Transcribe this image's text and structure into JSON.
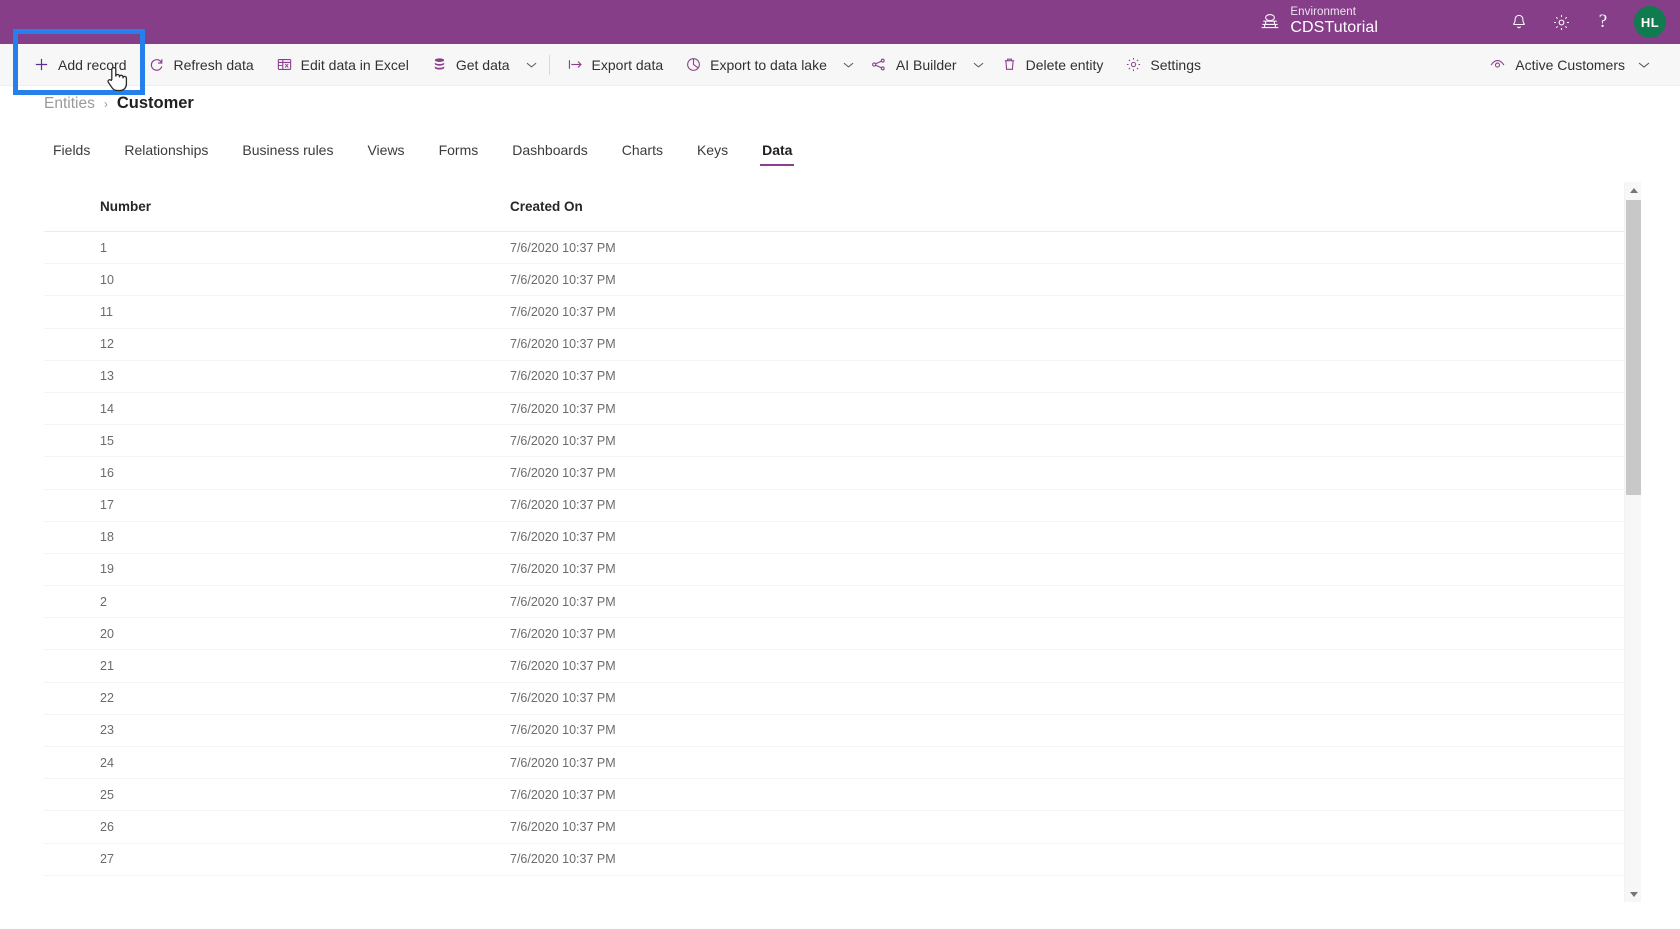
{
  "header": {
    "environment_label": "Environment",
    "environment_name": "CDSTutorial",
    "globe_icon": "environment-globe-icon",
    "notifications_icon": "bell-icon",
    "settings_icon": "gear-icon",
    "help_icon": "question-mark-icon",
    "help_glyph": "?",
    "avatar_initials": "HL",
    "brand_color": "#853e87",
    "avatar_color": "#0f7b4f"
  },
  "command_bar": {
    "buttons": [
      {
        "label": "Add record",
        "icon": "plus-icon",
        "has_caret": false,
        "highlighted": true
      },
      {
        "label": "Refresh data",
        "icon": "refresh-icon",
        "has_caret": false,
        "highlighted": false
      },
      {
        "label": "Edit data in Excel",
        "icon": "excel-icon",
        "has_caret": false,
        "highlighted": false
      },
      {
        "label": "Get data",
        "icon": "database-icon",
        "has_caret": true,
        "highlighted": false
      },
      {
        "label": "Export data",
        "icon": "export-arrow-icon",
        "has_caret": false,
        "highlighted": false
      },
      {
        "label": "Export to data lake",
        "icon": "data-lake-icon",
        "has_caret": true,
        "highlighted": false
      },
      {
        "label": "AI Builder",
        "icon": "ai-builder-icon",
        "has_caret": true,
        "highlighted": false
      },
      {
        "label": "Delete entity",
        "icon": "trash-icon",
        "has_caret": false,
        "highlighted": false
      },
      {
        "label": "Settings",
        "icon": "gear-icon",
        "has_caret": false,
        "highlighted": false
      }
    ],
    "view_selector": {
      "label": "Active Customers",
      "icon": "view-eye-icon",
      "caret_icon": "chevron-down-icon"
    },
    "highlight_color": "#2680eb",
    "cursor_icon": "hand-pointer-cursor"
  },
  "breadcrumb": {
    "parent": "Entities",
    "separator": "›",
    "current": "Customer"
  },
  "tabs": [
    {
      "label": "Fields",
      "active": false
    },
    {
      "label": "Relationships",
      "active": false
    },
    {
      "label": "Business rules",
      "active": false
    },
    {
      "label": "Views",
      "active": false
    },
    {
      "label": "Forms",
      "active": false
    },
    {
      "label": "Dashboards",
      "active": false
    },
    {
      "label": "Charts",
      "active": false
    },
    {
      "label": "Keys",
      "active": false
    },
    {
      "label": "Data",
      "active": true
    }
  ],
  "grid": {
    "columns": [
      {
        "key": "number",
        "label": "Number"
      },
      {
        "key": "created_on",
        "label": "Created On"
      }
    ],
    "rows": [
      {
        "number": "1",
        "created_on": "7/6/2020 10:37 PM"
      },
      {
        "number": "10",
        "created_on": "7/6/2020 10:37 PM"
      },
      {
        "number": "11",
        "created_on": "7/6/2020 10:37 PM"
      },
      {
        "number": "12",
        "created_on": "7/6/2020 10:37 PM"
      },
      {
        "number": "13",
        "created_on": "7/6/2020 10:37 PM"
      },
      {
        "number": "14",
        "created_on": "7/6/2020 10:37 PM"
      },
      {
        "number": "15",
        "created_on": "7/6/2020 10:37 PM"
      },
      {
        "number": "16",
        "created_on": "7/6/2020 10:37 PM"
      },
      {
        "number": "17",
        "created_on": "7/6/2020 10:37 PM"
      },
      {
        "number": "18",
        "created_on": "7/6/2020 10:37 PM"
      },
      {
        "number": "19",
        "created_on": "7/6/2020 10:37 PM"
      },
      {
        "number": "2",
        "created_on": "7/6/2020 10:37 PM"
      },
      {
        "number": "20",
        "created_on": "7/6/2020 10:37 PM"
      },
      {
        "number": "21",
        "created_on": "7/6/2020 10:37 PM"
      },
      {
        "number": "22",
        "created_on": "7/6/2020 10:37 PM"
      },
      {
        "number": "23",
        "created_on": "7/6/2020 10:37 PM"
      },
      {
        "number": "24",
        "created_on": "7/6/2020 10:37 PM"
      },
      {
        "number": "25",
        "created_on": "7/6/2020 10:37 PM"
      },
      {
        "number": "26",
        "created_on": "7/6/2020 10:37 PM"
      },
      {
        "number": "27",
        "created_on": "7/6/2020 10:37 PM"
      }
    ],
    "scrollbar": {
      "up_arrow_icon": "scroll-up-arrow-icon",
      "down_arrow_icon": "scroll-down-arrow-icon"
    }
  }
}
